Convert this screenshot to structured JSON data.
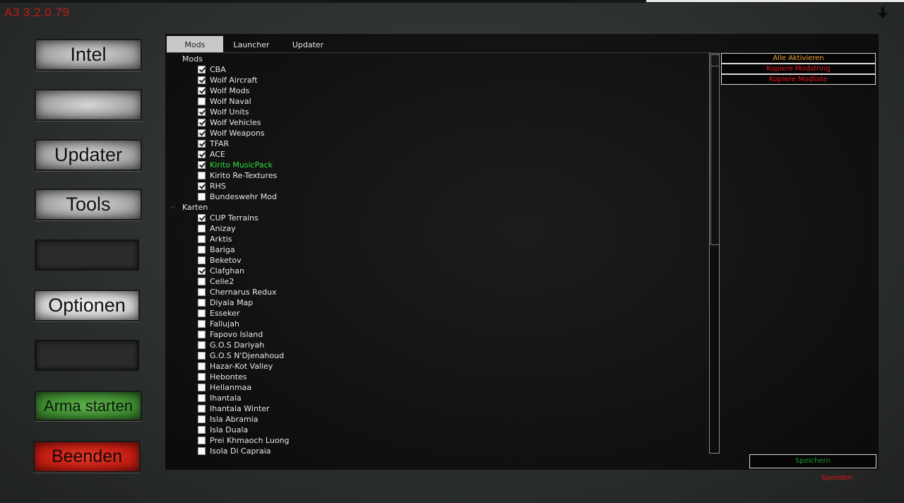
{
  "app": {
    "title": "A3 3.2.0.79"
  },
  "colors": {
    "title": "#c0191b",
    "accent_green": "#2ee23c",
    "orange": "#f0a030",
    "red": "#e8141a"
  },
  "nav": {
    "intel": "Intel",
    "blank1": "",
    "updater": "Updater",
    "tools": "Tools",
    "blank2": "",
    "optionen": "Optionen",
    "blank3": "",
    "arma_starten": "Arma starten",
    "beenden": "Beenden"
  },
  "tabs": [
    "Mods",
    "Launcher",
    "Updater"
  ],
  "tree": {
    "groups": [
      {
        "label": "Mods",
        "collapse_icon": "none"
      },
      {
        "label": "Karten",
        "collapse_icon": "chevron-down-icon"
      }
    ],
    "mods": [
      {
        "label": "CBA",
        "checked": true
      },
      {
        "label": "Wolf Aircraft",
        "checked": true
      },
      {
        "label": "Wolf Mods",
        "checked": true
      },
      {
        "label": "Wolf Naval",
        "checked": false
      },
      {
        "label": "Wolf Units",
        "checked": true
      },
      {
        "label": "Wolf Vehicles",
        "checked": true
      },
      {
        "label": "Wolf Weapons",
        "checked": true
      },
      {
        "label": "TFAR",
        "checked": true
      },
      {
        "label": "ACE",
        "checked": true
      },
      {
        "label": "Kirito MusicPack",
        "checked": true,
        "highlight": true
      },
      {
        "label": "Kirito Re-Textures",
        "checked": false
      },
      {
        "label": "RHS",
        "checked": true
      },
      {
        "label": "Bundeswehr Mod",
        "checked": false
      }
    ],
    "karten": [
      {
        "label": "CUP Terrains",
        "checked": true
      },
      {
        "label": "Anizay",
        "checked": false
      },
      {
        "label": "Arktis",
        "checked": false
      },
      {
        "label": "Bariga",
        "checked": false
      },
      {
        "label": "Beketov",
        "checked": false
      },
      {
        "label": "Clafghan",
        "checked": true
      },
      {
        "label": "Celle2",
        "checked": false
      },
      {
        "label": "Chernarus Redux",
        "checked": false
      },
      {
        "label": "Diyala Map",
        "checked": false
      },
      {
        "label": "Esseker",
        "checked": false
      },
      {
        "label": "Fallujah",
        "checked": false
      },
      {
        "label": "Fapovo Island",
        "checked": false
      },
      {
        "label": "G.O.S Dariyah",
        "checked": false
      },
      {
        "label": "G.O.S N'Djenahoud",
        "checked": false
      },
      {
        "label": "Hazar-Kot Valley",
        "checked": false
      },
      {
        "label": "Hebontes",
        "checked": false
      },
      {
        "label": "Hellanmaa",
        "checked": false
      },
      {
        "label": "Ihantala",
        "checked": false
      },
      {
        "label": "Ihantala Winter",
        "checked": false
      },
      {
        "label": "Isla Abramia",
        "checked": false
      },
      {
        "label": "Isla Duala",
        "checked": false
      },
      {
        "label": "Prei Khmaoch Luong",
        "checked": false
      },
      {
        "label": "Isola Di Capraia",
        "checked": false
      }
    ]
  },
  "actions": {
    "alle_aktivieren": "Alle Aktivieren",
    "kopiere_modstring": "Kopiere Modstring",
    "kopiere_modliste": "Kopiere Modliste",
    "speichern": "Speichern",
    "spenden": "Spenden"
  },
  "icons": {
    "download": "download-arrow-icon",
    "collapse": "chevron-down-icon",
    "checkbox": "checkbox-icon"
  }
}
